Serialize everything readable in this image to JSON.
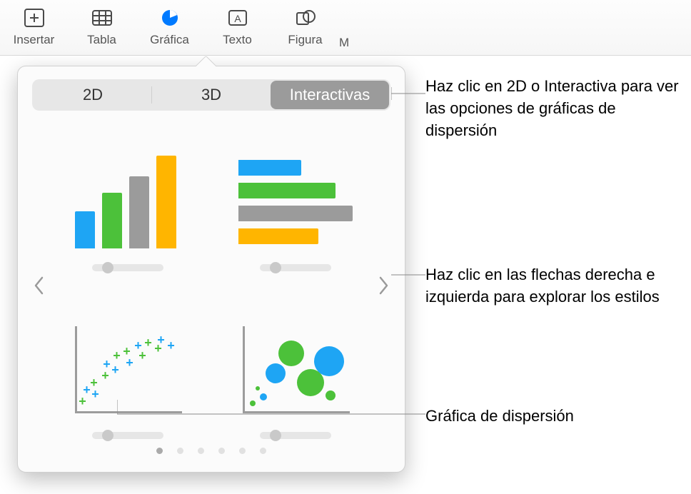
{
  "toolbar": {
    "items": [
      {
        "label": "Insertar",
        "icon": "insert"
      },
      {
        "label": "Tabla",
        "icon": "table"
      },
      {
        "label": "Gráfica",
        "icon": "chart",
        "active": true
      },
      {
        "label": "Texto",
        "icon": "text"
      },
      {
        "label": "Figura",
        "icon": "shape"
      }
    ],
    "overflow_label": "M"
  },
  "popover": {
    "tabs": [
      "2D",
      "3D",
      "Interactivas"
    ],
    "selected_tab_index": 2,
    "page_count": 6,
    "current_page_index": 0,
    "colors": {
      "blue": "#1ea5f4",
      "green": "#4cc13a",
      "grey": "#9b9b9b",
      "orange": "#ffb500"
    },
    "thumbs": [
      {
        "kind": "column-chart"
      },
      {
        "kind": "bar-chart"
      },
      {
        "kind": "scatter-chart"
      },
      {
        "kind": "bubble-chart"
      }
    ]
  },
  "callouts": {
    "tabs_hint": "Haz clic en 2D o Interactiva para ver las opciones de gráficas de dispersión",
    "arrows_hint": "Haz clic en las flechas derecha e izquierda para explorar los estilos",
    "scatter_label": "Gráfica de dispersión"
  }
}
